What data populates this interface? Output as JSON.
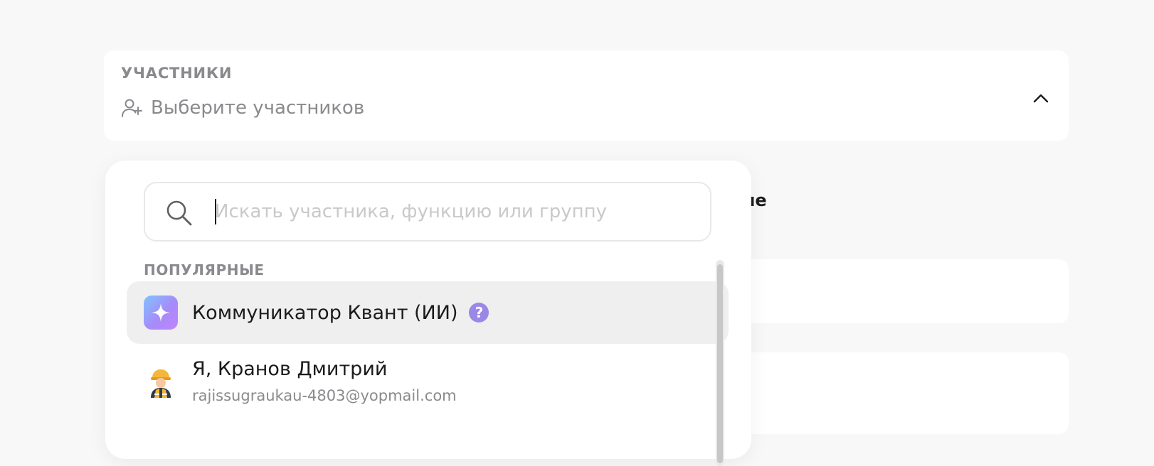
{
  "participants": {
    "title": "УЧАСТНИКИ",
    "placeholder": "Выберите участников",
    "icon": "add-user-icon",
    "toggle_icon": "chevron-up-icon"
  },
  "background": {
    "heading_fragment": "ние"
  },
  "dropdown": {
    "search": {
      "placeholder": "Искать участника, функцию или группу",
      "value": "",
      "icon": "search-icon"
    },
    "section_label": "ПОПУЛЯРНЫЕ",
    "items": [
      {
        "name": "Коммуникатор Квант (ИИ)",
        "type": "ai-assistant",
        "help_icon": "?",
        "hovered": true
      },
      {
        "name": "Я, Кранов Дмитрий",
        "email": "rajissugraukau-4803@yopmail.com",
        "type": "user"
      }
    ]
  },
  "colors": {
    "accent": "#9b87e6",
    "muted_text": "#8a8a8e",
    "hover_bg": "#efefef"
  }
}
